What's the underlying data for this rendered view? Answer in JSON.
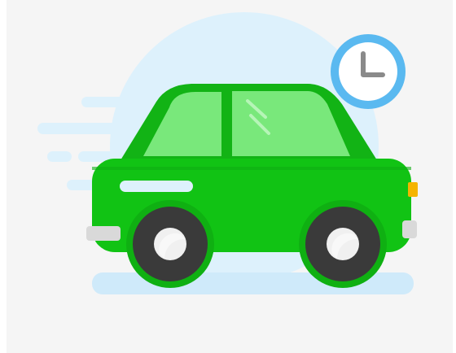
{
  "illustration": {
    "subject": "car-speeding-with-clock",
    "icons": [
      "car-icon",
      "clock-icon"
    ],
    "colors": {
      "background": "#f5f5f5",
      "halo": "#ddf1fc",
      "car_body": "#11c314",
      "car_roof": "#12b315",
      "window": "#79e87b",
      "wheel": "#3a3a3a",
      "hub": "#f0f0f0",
      "bumper": "#d9d9d9",
      "light": "#f5b400",
      "motion_lines": "#ddf1fc",
      "shadow": "#cfeafa",
      "clock_ring": "#5ab9f0",
      "clock_face": "#ffffff",
      "clock_hands": "#8a8a8a"
    }
  }
}
